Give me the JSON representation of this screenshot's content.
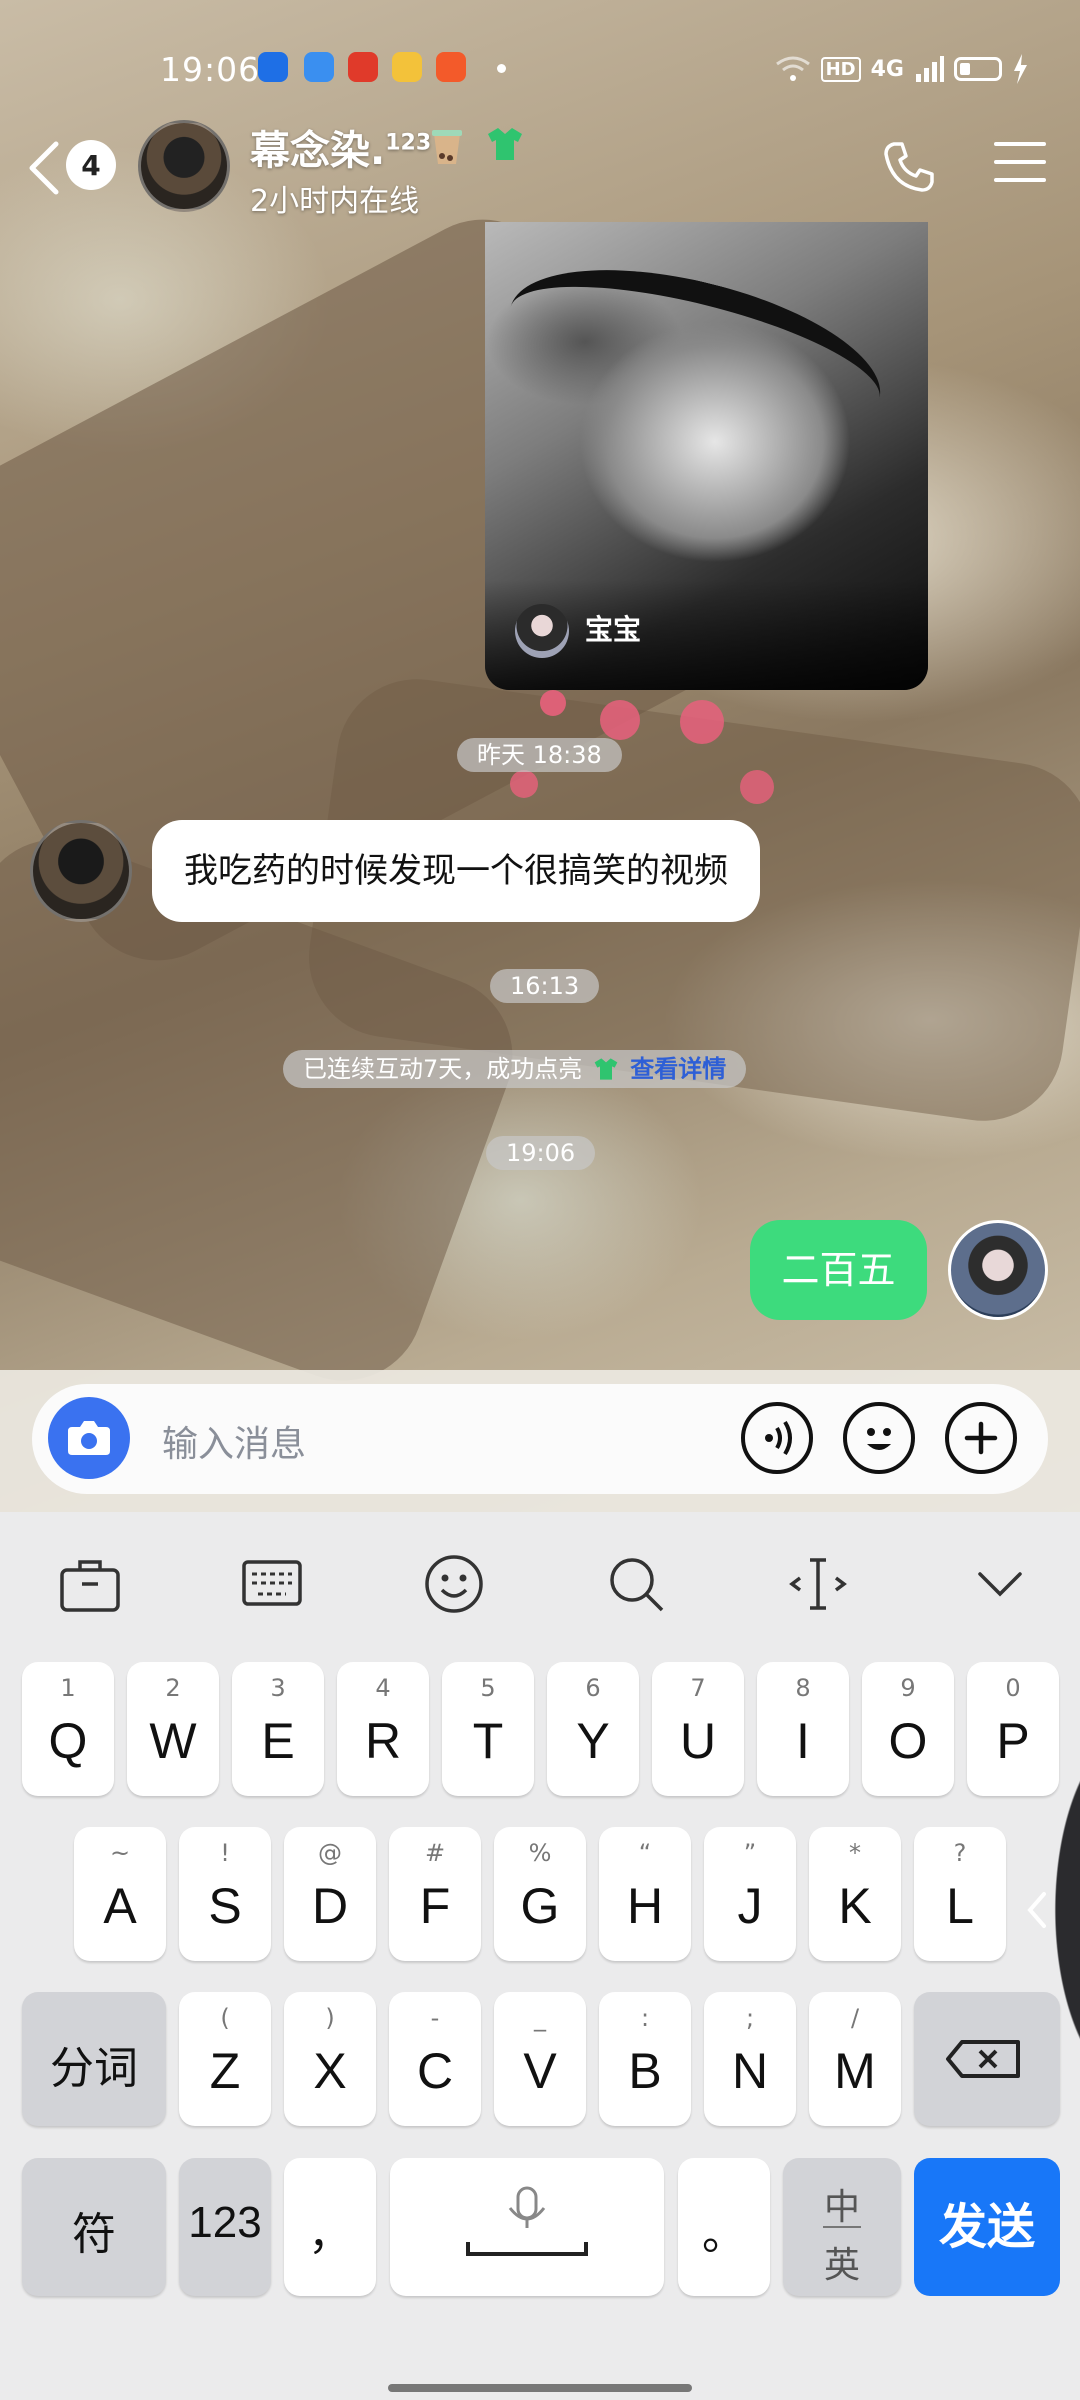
{
  "status_bar": {
    "time": "19:06",
    "hd": "HD",
    "net": "4G"
  },
  "header": {
    "unread_count": "4",
    "contact_name": "幕念染.",
    "name_suffix": "123",
    "status": "2小时内在线"
  },
  "video_card": {
    "author": "宝宝"
  },
  "messages": {
    "ts_yesterday": "昨天 18:38",
    "incoming_text": "我吃药的时候发现一个很搞笑的视频",
    "ts_1613": "16:13",
    "notice_text": "已连续互动7天，成功点亮",
    "notice_link": "查看详情",
    "ts_1906": "19:06",
    "outgoing_text": "二百五"
  },
  "input": {
    "placeholder": "输入消息"
  },
  "keyboard": {
    "row1": [
      {
        "sub": "1",
        "main": "Q"
      },
      {
        "sub": "2",
        "main": "W"
      },
      {
        "sub": "3",
        "main": "E"
      },
      {
        "sub": "4",
        "main": "R"
      },
      {
        "sub": "5",
        "main": "T"
      },
      {
        "sub": "6",
        "main": "Y"
      },
      {
        "sub": "7",
        "main": "U"
      },
      {
        "sub": "8",
        "main": "I"
      },
      {
        "sub": "9",
        "main": "O"
      },
      {
        "sub": "0",
        "main": "P"
      }
    ],
    "row2": [
      {
        "sub": "~",
        "main": "A"
      },
      {
        "sub": "!",
        "main": "S"
      },
      {
        "sub": "@",
        "main": "D"
      },
      {
        "sub": "#",
        "main": "F"
      },
      {
        "sub": "%",
        "main": "G"
      },
      {
        "sub": "“",
        "main": "H"
      },
      {
        "sub": "”",
        "main": "J"
      },
      {
        "sub": "*",
        "main": "K"
      },
      {
        "sub": "?",
        "main": "L"
      }
    ],
    "row3": [
      {
        "sub": "(",
        "main": "Z"
      },
      {
        "sub": ")",
        "main": "X"
      },
      {
        "sub": "-",
        "main": "C"
      },
      {
        "sub": "_",
        "main": "V"
      },
      {
        "sub": ":",
        "main": "B"
      },
      {
        "sub": ";",
        "main": "N"
      },
      {
        "sub": "/",
        "main": "M"
      }
    ],
    "segment_key": "分词",
    "symbol_key": "符",
    "num_key": "123",
    "comma_key": "，",
    "period_key": "。",
    "lang_top": "中",
    "lang_bottom": "英",
    "send_key": "发送"
  },
  "colors": {
    "send": "#1877f8",
    "outgoing_bubble": "#3ddb7d",
    "camera": "#3a72f0",
    "link": "#2e5fd6"
  }
}
